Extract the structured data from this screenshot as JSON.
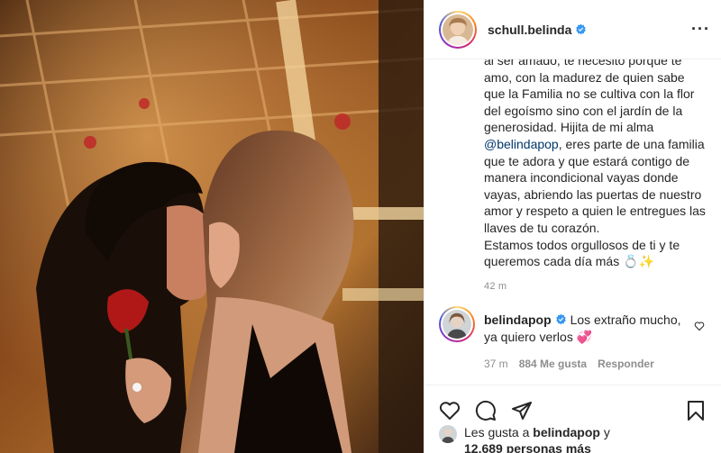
{
  "post": {
    "author": "schull.belinda",
    "more_icon": "more-horizontal-icon",
    "caption_lines": "al ser amado, te necesito porque te\namo, con la madurez de quien sabe\nque la Familia no se cultiva con la flor\ndel egoísmo sino con el jardín de la\ngenerosidad. Hijita de mi alma",
    "caption_mention": "@belindapop",
    "caption_rest": ", eres parte de una familia\nque te adora y que estará contigo de\nmanera incondicional vayas donde\nvayas, abriendo las puertas de nuestro\namor y respeto a quien le entregues las\nllaves de tu corazón.\nEstamos todos orgullosos de ti y te\nqueremos cada día más 💍✨",
    "caption_time": "42 m"
  },
  "comment": {
    "author": "belindapop",
    "text": "Los extraño mucho,\nya quiero verlos 💞",
    "time": "37 m",
    "likes": "884 Me gusta",
    "reply": "Responder"
  },
  "likes": {
    "prefix": "Les gusta a ",
    "user": "belindapop",
    "joiner": " y",
    "count": "12.689 personas más"
  },
  "colors": {
    "verified": "#3897f0",
    "link": "#00376b",
    "muted": "#8e8e8e"
  }
}
